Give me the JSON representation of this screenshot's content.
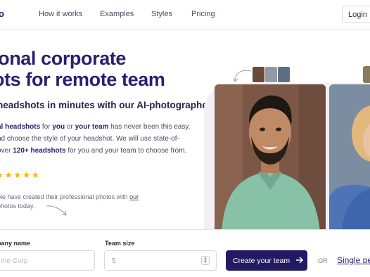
{
  "nav": {
    "logo_text": "o",
    "links": [
      "How it works",
      "Examples",
      "Styles",
      "Pricing"
    ],
    "login_label": "Login"
  },
  "hero": {
    "headline_line1": "ional corporate",
    "headline_line2": "ots for remote team",
    "subheadline": "headshots in minutes with our AI-photographer",
    "desc_line1": {
      "bold1": "al headshots",
      "t1": " for ",
      "bold2": "you",
      "t2": " or ",
      "bold3": "your team",
      "t3": " has never been this easy."
    },
    "desc_line2": "nd choose the style of your headshot. We will use state-of-",
    "desc_line3": {
      "t1": "over ",
      "bold": "120+ headshots",
      "t2": " for you and your team to choose from."
    },
    "stars": "★★★★★",
    "people_line1": {
      "t1": "ple have created their professional photos with ",
      "link": "our"
    },
    "people_line2": "photos today."
  },
  "colors": {
    "brand": "#221b63",
    "star": "#f5b301"
  },
  "form": {
    "company_label": "pany name",
    "company_placeholder": "me Corp",
    "team_size_label": "Team size",
    "team_size_value": "5",
    "create_button": "Create your team",
    "create_icon": "arrow-right-icon",
    "or_text": "OR",
    "single_link": "Single pe"
  }
}
